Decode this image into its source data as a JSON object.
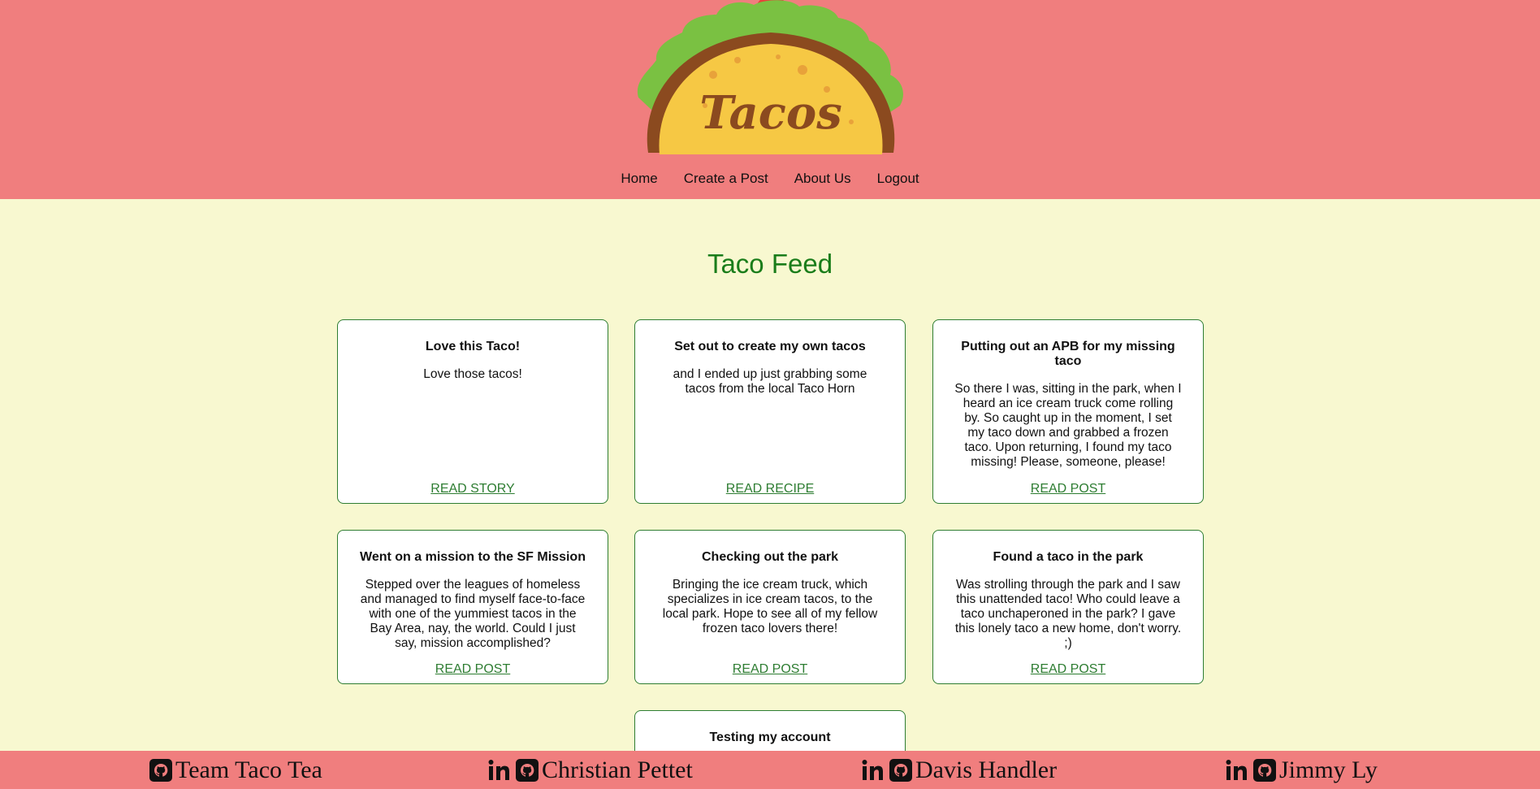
{
  "header": {
    "logo_text": "Tacos",
    "nav": [
      {
        "label": "Home"
      },
      {
        "label": "Create a Post"
      },
      {
        "label": "About Us"
      },
      {
        "label": "Logout"
      }
    ]
  },
  "main": {
    "title": "Taco Feed",
    "posts": [
      {
        "title": "Love this Taco!",
        "body": "Love those tacos!",
        "link": "READ STORY"
      },
      {
        "title": "Set out to create my own tacos",
        "body": "and I ended up just grabbing some tacos from the local Taco Horn",
        "link": "READ RECIPE"
      },
      {
        "title": "Putting out an APB for my missing taco",
        "body": "So there I was, sitting in the park, when I heard an ice cream truck come rolling by. So caught up in the moment, I set my taco down and grabbed a frozen taco. Upon returning, I found my taco missing! Please, someone, please!",
        "link": "READ POST"
      },
      {
        "title": "Went on a mission to the SF Mission",
        "body": "Stepped over the leagues of homeless and managed to find myself face-to-face with one of the yummiest tacos in the Bay Area, nay, the world. Could I just say, mission accomplished?",
        "link": "READ POST"
      },
      {
        "title": "Checking out the park",
        "body": "Bringing the ice cream truck, which specializes in ice cream tacos, to the local park. Hope to see all of my fellow frozen taco lovers there!",
        "link": "READ POST"
      },
      {
        "title": "Found a taco in the park",
        "body": "Was strolling through the park and I saw this unattended taco! Who could leave a taco unchaperoned in the park? I gave this lonely taco a new home, don't worry. ;)",
        "link": "READ POST"
      },
      {
        "title": "Testing my account",
        "body": "",
        "link": ""
      }
    ]
  },
  "footer": {
    "items": [
      {
        "name": "Team Taco Tea",
        "icons": [
          "github-icon"
        ]
      },
      {
        "name": "Christian Pettet",
        "icons": [
          "linkedin-icon",
          "github-icon"
        ]
      },
      {
        "name": "Davis Handler",
        "icons": [
          "linkedin-icon",
          "github-icon"
        ]
      },
      {
        "name": "Jimmy Ly",
        "icons": [
          "linkedin-icon",
          "github-icon"
        ]
      }
    ]
  },
  "colors": {
    "header_bg": "#f07e7e",
    "page_bg": "#f8f8d0",
    "accent_green": "#2e7d32",
    "title_green": "#1a7d1a"
  }
}
